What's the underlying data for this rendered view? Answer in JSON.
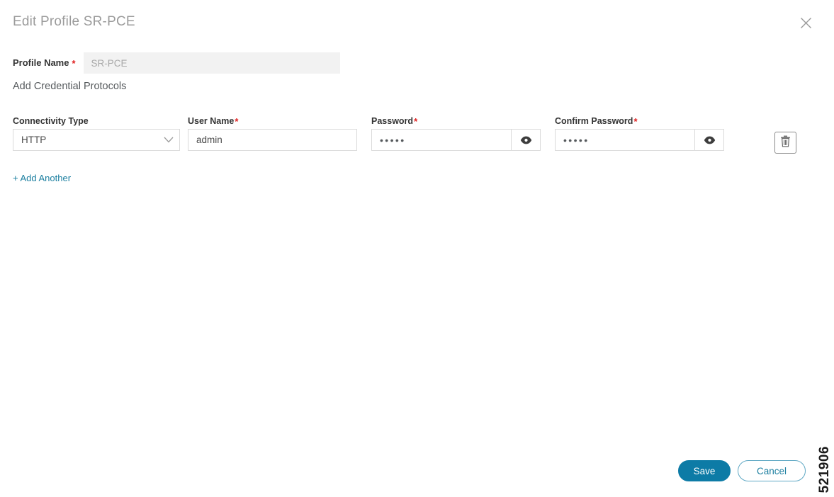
{
  "dialog": {
    "title": "Edit Profile SR-PCE",
    "close_icon": "close-icon"
  },
  "profile": {
    "label": "Profile Name",
    "required_mark": "*",
    "value": "SR-PCE",
    "disabled": "true"
  },
  "section": {
    "title": "Add Credential Protocols"
  },
  "credential_columns": {
    "connectivity_type": "Connectivity Type",
    "user_name": "User Name",
    "password": "Password",
    "confirm_password": "Confirm Password",
    "required_mark": "*"
  },
  "credential_row": {
    "connectivity_type_value": "HTTP",
    "connectivity_type_icon": "chevron-down-icon",
    "user_name_value": "admin",
    "password_value": "•••••",
    "password_reveal_icon": "eye-icon",
    "confirm_password_value": "•••••",
    "confirm_password_reveal_icon": "eye-icon",
    "delete_icon": "trash-icon"
  },
  "actions": {
    "add_another": "+ Add Another",
    "save": "Save",
    "cancel": "Cancel"
  },
  "watermark": {
    "text": "521906"
  },
  "colors": {
    "accent": "#0d7ba6",
    "link": "#1c7fa0",
    "required": "#e02020",
    "title_gray": "#9b9b9b",
    "border": "#dadada",
    "disabled_bg": "#f2f2f2"
  }
}
